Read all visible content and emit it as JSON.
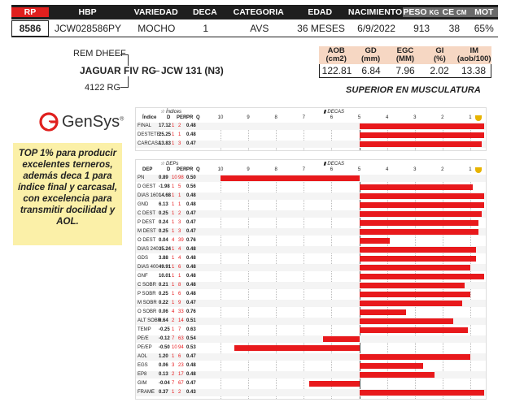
{
  "header": {
    "cols": [
      "RP",
      "HBP",
      "VARIEDAD",
      "DECA",
      "CATEGORIA",
      "EDAD",
      "NACIMIENTO",
      "PESO",
      "CE",
      "MOT"
    ],
    "units": {
      "peso": "KG",
      "ce": "CM"
    },
    "values": [
      "8586",
      "JCW028586PY",
      "MOCHO",
      "1",
      "AVS",
      "36 MESES",
      "6/9/2022",
      "913",
      "38",
      "65%"
    ]
  },
  "pedigree": {
    "sire_top": "REM DHEEF",
    "sire": "JAGUAR FIV RG",
    "dam_bottom": "4122 RG",
    "animal": "JCW 131 (N3)"
  },
  "ultrasound": {
    "heads": [
      [
        "AOB",
        "(cm2)"
      ],
      [
        "GD",
        "(mm)"
      ],
      [
        "EGC",
        "(MM)"
      ],
      [
        "GI",
        "(%)"
      ],
      [
        "IM",
        "(aob/100)"
      ]
    ],
    "values": [
      "122.81",
      "6.84",
      "7.96",
      "2.02",
      "13.38"
    ],
    "note": "SUPERIOR EN MUSCULATURA"
  },
  "logo": {
    "name": "GenSys",
    "mark": "®"
  },
  "promo": "TOP 1% para producir excelentes terneros, además deca 1 para índice final y carcasal, con excelencia para transmitir docilidad y AOL.",
  "colors": {
    "red": "#e8191c",
    "header_bg": "#1e1e1e",
    "us_bg": "#f6d7c3",
    "promo_bg": "#fbf0a8"
  },
  "chart_data": [
    {
      "type": "bar",
      "title": "Índices",
      "scale_title": "DECAS",
      "columns": [
        "Índice",
        "D",
        "PER",
        "PR",
        "Q"
      ],
      "ticks": [
        "10",
        "9",
        "8",
        "7",
        "6",
        "5",
        "4",
        "3",
        "2",
        "1"
      ],
      "rows": [
        {
          "name": "FINAL",
          "val": "17.12",
          "d": "1",
          "per": "2",
          "pr": "0.48",
          "bar": [
            5,
            0.5
          ]
        },
        {
          "name": "DESTETE",
          "val": "25.25",
          "d": "1",
          "per": "1",
          "pr": "0.48",
          "bar": [
            5,
            0.5
          ]
        },
        {
          "name": "CARCASA",
          "val": "13.83",
          "d": "1",
          "per": "3",
          "pr": "0.47",
          "bar": [
            5,
            0.6
          ]
        }
      ]
    },
    {
      "type": "bar",
      "title": "DEPs",
      "scale_title": "DECAS",
      "columns": [
        "DEP",
        "D",
        "PER",
        "PR",
        "Q"
      ],
      "ticks": [
        "10",
        "9",
        "8",
        "7",
        "6",
        "5",
        "4",
        "3",
        "2",
        "1"
      ],
      "rows": [
        {
          "name": "PN",
          "val": "0.89",
          "d": "10",
          "per": "98",
          "pr": "0.50",
          "bar": [
            5,
            10
          ]
        },
        {
          "name": "D GEST",
          "val": "-1.98",
          "d": "1",
          "per": "5",
          "pr": "0.56",
          "bar": [
            5,
            0.9
          ]
        },
        {
          "name": "DIAS 160",
          "val": "14.68",
          "d": "1",
          "per": "1",
          "pr": "0.48",
          "bar": [
            5,
            0.5
          ]
        },
        {
          "name": "GND",
          "val": "6.13",
          "d": "1",
          "per": "1",
          "pr": "0.48",
          "bar": [
            5,
            0.5
          ]
        },
        {
          "name": "C DEST",
          "val": "0.25",
          "d": "1",
          "per": "2",
          "pr": "0.47",
          "bar": [
            5,
            0.6
          ]
        },
        {
          "name": "P DEST",
          "val": "0.24",
          "d": "1",
          "per": "3",
          "pr": "0.47",
          "bar": [
            5,
            0.7
          ]
        },
        {
          "name": "M DEST",
          "val": "0.25",
          "d": "1",
          "per": "3",
          "pr": "0.47",
          "bar": [
            5,
            0.7
          ]
        },
        {
          "name": "O DEST",
          "val": "0.04",
          "d": "4",
          "per": "39",
          "pr": "0.76",
          "bar": [
            5,
            3.9
          ]
        },
        {
          "name": "DIAS 240",
          "val": "35.24",
          "d": "1",
          "per": "4",
          "pr": "0.48",
          "bar": [
            5,
            0.8
          ]
        },
        {
          "name": "GDS",
          "val": "3.88",
          "d": "1",
          "per": "4",
          "pr": "0.48",
          "bar": [
            5,
            0.8
          ]
        },
        {
          "name": "DIAS 400",
          "val": "49.91",
          "d": "1",
          "per": "6",
          "pr": "0.48",
          "bar": [
            5,
            1.0
          ]
        },
        {
          "name": "GNF",
          "val": "10.01",
          "d": "1",
          "per": "1",
          "pr": "0.48",
          "bar": [
            5,
            0.5
          ]
        },
        {
          "name": "C SOBR",
          "val": "0.21",
          "d": "1",
          "per": "8",
          "pr": "0.48",
          "bar": [
            5,
            1.2
          ]
        },
        {
          "name": "P SOBR",
          "val": "0.25",
          "d": "1",
          "per": "6",
          "pr": "0.48",
          "bar": [
            5,
            1.0
          ]
        },
        {
          "name": "M SOBR",
          "val": "0.22",
          "d": "1",
          "per": "9",
          "pr": "0.47",
          "bar": [
            5,
            1.3
          ]
        },
        {
          "name": "O SOBR",
          "val": "0.06",
          "d": "4",
          "per": "33",
          "pr": "0.76",
          "bar": [
            5,
            3.3
          ]
        },
        {
          "name": "ALT SOBR",
          "val": "0.64",
          "d": "2",
          "per": "14",
          "pr": "0.51",
          "bar": [
            5,
            1.6
          ]
        },
        {
          "name": "TEMP",
          "val": "-0.25",
          "d": "1",
          "per": "7",
          "pr": "0.63",
          "bar": [
            5,
            1.1
          ]
        },
        {
          "name": "PE/E",
          "val": "-0.12",
          "d": "7",
          "per": "63",
          "pr": "0.54",
          "bar": [
            6.3,
            5
          ]
        },
        {
          "name": "PE/EP",
          "val": "-0.50",
          "d": "10",
          "per": "94",
          "pr": "0.53",
          "bar": [
            9.5,
            5
          ]
        },
        {
          "name": "AOL",
          "val": "1.20",
          "d": "1",
          "per": "6",
          "pr": "0.47",
          "bar": [
            5,
            1.0
          ]
        },
        {
          "name": "EGS",
          "val": "0.06",
          "d": "3",
          "per": "23",
          "pr": "0.48",
          "bar": [
            5,
            2.7
          ]
        },
        {
          "name": "EP8",
          "val": "0.13",
          "d": "2",
          "per": "17",
          "pr": "0.48",
          "bar": [
            5,
            2.3
          ]
        },
        {
          "name": "GIM",
          "val": "-0.04",
          "d": "7",
          "per": "67",
          "pr": "0.47",
          "bar": [
            6.8,
            5
          ]
        },
        {
          "name": "FRAME",
          "val": "0.37",
          "d": "1",
          "per": "2",
          "pr": "0.43",
          "bar": [
            5,
            0.5
          ]
        }
      ]
    }
  ]
}
